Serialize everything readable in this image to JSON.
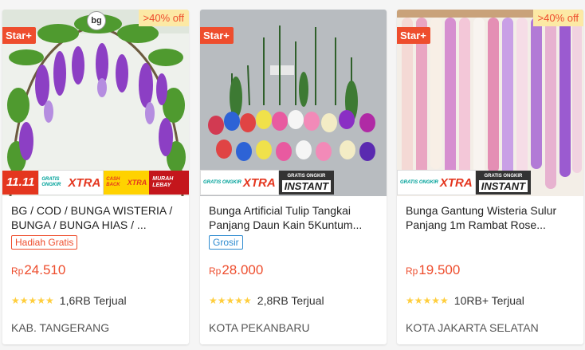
{
  "products": [
    {
      "title": "BG / COD / BUNGA WISTERIA / BUNGA / BUNGA HIAS / ...",
      "tag": "Hadiah Gratis",
      "currency": "Rp",
      "price": "24.510",
      "sold": "1,6RB Terjual",
      "location": "KAB. TANGERANG",
      "star_badge": "Star+",
      "discount": ">40% off",
      "logo_text": "bg",
      "promo": {
        "p1111": "11.11",
        "xtra_top": "GRATIS ONGKIR",
        "xtra_main": "XTRA",
        "cash_top": "CASH BACK",
        "cash_main": "XTRA",
        "murah": "MURAH LEBAY"
      }
    },
    {
      "title": "Bunga Artificial Tulip Tangkai Panjang Daun Kain 5Kuntum...",
      "tag": "Grosir",
      "currency": "Rp",
      "price": "28.000",
      "sold": "2,8RB Terjual",
      "location": "KOTA PEKANBARU",
      "star_badge": "Star+",
      "promo": {
        "xtra_top": "GRATIS ONGKIR",
        "xtra_main": "XTRA",
        "instant_top": "GRATIS ONGKIR",
        "instant_main": "INSTANT"
      }
    },
    {
      "title": "Bunga Gantung Wisteria Sulur Panjang 1m Rambat Rose...",
      "currency": "Rp",
      "price": "19.500",
      "sold": "10RB+ Terjual",
      "location": "KOTA JAKARTA SELATAN",
      "star_badge": "Star+",
      "discount": ">40% off",
      "promo": {
        "xtra_top": "GRATIS ONGKIR",
        "xtra_main": "XTRA",
        "instant_top": "GRATIS ONGKIR",
        "instant_main": "INSTANT"
      }
    }
  ],
  "stars": "★★★★★",
  "colors": {
    "accent": "#ee4d2d",
    "star": "#ffce3d",
    "discount_bg": "#fce9a5"
  }
}
